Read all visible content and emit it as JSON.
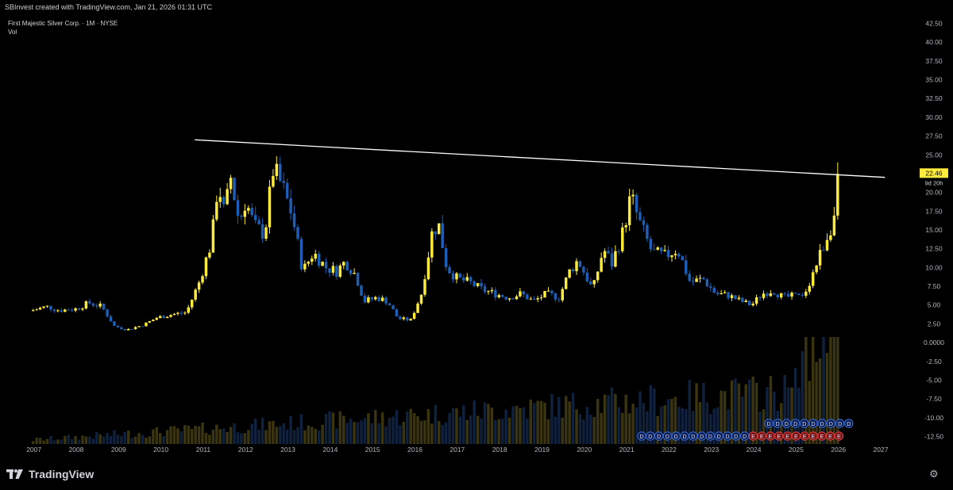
{
  "header": {
    "attribution": "SBInvest created with TradingView.com, Jan 21, 2026 01:31 UTC"
  },
  "legend": {
    "symbol": "First Majestic Silver Corp. · 1M · NYSE",
    "indicator": "Vol"
  },
  "brand": {
    "name": "TradingView"
  },
  "colors": {
    "bull": "#ffeb3b",
    "bear": "#1e5fb5",
    "background": "#000000",
    "trendline": "#ffffff",
    "vol_bull": "#3a3510",
    "vol_bear": "#10213d",
    "price_label_bg": "#ffeb3b"
  },
  "icons": {
    "logo": "tradingview-logo-icon",
    "settings": "gear-icon"
  },
  "chart_data": {
    "type": "candlestick",
    "title": "First Majestic Silver Corp. · 1M · NYSE",
    "timeframe": "1M",
    "ylim": [
      -13.5,
      43.5
    ],
    "y_ticks": [
      "42.50",
      "40.00",
      "37.50",
      "35.00",
      "32.50",
      "30.00",
      "27.50",
      "25.00",
      "20.00",
      "17.50",
      "15.00",
      "12.50",
      "10.00",
      "7.50",
      "5.00",
      "2.50",
      "0.0000",
      "-2.50",
      "-5.00",
      "-7.50",
      "-10.00",
      "-12.50"
    ],
    "y_tick_values": [
      42.5,
      40,
      37.5,
      35,
      32.5,
      30,
      27.5,
      25,
      20,
      17.5,
      15,
      12.5,
      10,
      7.5,
      5,
      2.5,
      0,
      -2.5,
      -5,
      -7.5,
      -10,
      -12.5
    ],
    "x_ticks": [
      "2007",
      "2008",
      "2009",
      "2010",
      "2011",
      "2012",
      "2013",
      "2014",
      "2015",
      "2016",
      "2017",
      "2018",
      "2019",
      "2020",
      "2021",
      "2022",
      "2023",
      "2024",
      "2025",
      "2026",
      "2027"
    ],
    "x_tick_years": [
      2007,
      2008,
      2009,
      2010,
      2011,
      2012,
      2013,
      2014,
      2015,
      2016,
      2017,
      2018,
      2019,
      2020,
      2021,
      2022,
      2023,
      2024,
      2025,
      2026,
      2027
    ],
    "xlim": [
      2006.2,
      2027.9
    ],
    "last_price": "22.46",
    "countdown": "9d 20h",
    "last_price_value": 22.46,
    "grid": false,
    "series": [
      {
        "name": "First Majestic Silver Corp.",
        "anchors": [
          [
            2006.9,
            4.2
          ],
          [
            2007.3,
            4.8
          ],
          [
            2007.6,
            4.3
          ],
          [
            2008.0,
            4.5
          ],
          [
            2008.3,
            5.3
          ],
          [
            2008.6,
            4.8
          ],
          [
            2008.9,
            2.2
          ],
          [
            2009.2,
            1.7
          ],
          [
            2009.6,
            2.4
          ],
          [
            2009.9,
            3.3
          ],
          [
            2010.3,
            3.8
          ],
          [
            2010.6,
            4.0
          ],
          [
            2010.9,
            8.0
          ],
          [
            2011.2,
            13.5
          ],
          [
            2011.35,
            21.5
          ],
          [
            2011.5,
            17.0
          ],
          [
            2011.65,
            22.0
          ],
          [
            2011.85,
            16.0
          ],
          [
            2012.0,
            19.0
          ],
          [
            2012.2,
            15.5
          ],
          [
            2012.45,
            14.5
          ],
          [
            2012.65,
            23.0
          ],
          [
            2012.85,
            21.0
          ],
          [
            2013.1,
            17.0
          ],
          [
            2013.35,
            9.5
          ],
          [
            2013.6,
            12.0
          ],
          [
            2013.9,
            10.0
          ],
          [
            2014.15,
            9.5
          ],
          [
            2014.35,
            10.8
          ],
          [
            2014.6,
            9.0
          ],
          [
            2014.8,
            5.5
          ],
          [
            2015.1,
            6.0
          ],
          [
            2015.35,
            5.5
          ],
          [
            2015.6,
            3.2
          ],
          [
            2015.9,
            3.0
          ],
          [
            2016.15,
            6.5
          ],
          [
            2016.4,
            14.5
          ],
          [
            2016.55,
            16.0
          ],
          [
            2016.75,
            10.0
          ],
          [
            2017.0,
            8.5
          ],
          [
            2017.3,
            8.0
          ],
          [
            2017.6,
            7.0
          ],
          [
            2017.9,
            6.5
          ],
          [
            2018.2,
            6.0
          ],
          [
            2018.5,
            6.5
          ],
          [
            2018.8,
            5.5
          ],
          [
            2019.1,
            6.5
          ],
          [
            2019.4,
            6.0
          ],
          [
            2019.65,
            9.5
          ],
          [
            2019.85,
            11.0
          ],
          [
            2020.2,
            7.0
          ],
          [
            2020.45,
            12.5
          ],
          [
            2020.65,
            10.5
          ],
          [
            2020.9,
            14.5
          ],
          [
            2021.0,
            17.0
          ],
          [
            2021.1,
            19.5
          ],
          [
            2021.3,
            16.0
          ],
          [
            2021.6,
            12.0
          ],
          [
            2021.9,
            11.5
          ],
          [
            2022.2,
            12.5
          ],
          [
            2022.5,
            8.0
          ],
          [
            2022.8,
            8.5
          ],
          [
            2023.1,
            6.5
          ],
          [
            2023.4,
            6.3
          ],
          [
            2023.7,
            5.5
          ],
          [
            2023.95,
            5.0
          ],
          [
            2024.2,
            6.5
          ],
          [
            2024.45,
            7.0
          ],
          [
            2024.7,
            6.0
          ],
          [
            2024.95,
            6.2
          ],
          [
            2025.15,
            6.0
          ],
          [
            2025.35,
            8.5
          ],
          [
            2025.55,
            11.5
          ],
          [
            2025.75,
            14.5
          ],
          [
            2025.95,
            17.5
          ],
          [
            2026.0,
            22.46
          ]
        ]
      }
    ],
    "annotations": {
      "trendline": {
        "from": [
          2010.8,
          27.0
        ],
        "to": [
          2027.1,
          22.0
        ]
      },
      "marker_row_upper": [
        "D",
        "D",
        "D",
        "D",
        "D",
        "D",
        "D",
        "D",
        "D",
        "D"
      ],
      "marker_row_lower": [
        "D",
        "D",
        "D",
        "D",
        "D",
        "D",
        "D",
        "D",
        "D",
        "D",
        "D",
        "D",
        "D",
        "E",
        "E",
        "E",
        "E",
        "E",
        "E",
        "E",
        "E",
        "E",
        "E",
        "E"
      ]
    }
  }
}
